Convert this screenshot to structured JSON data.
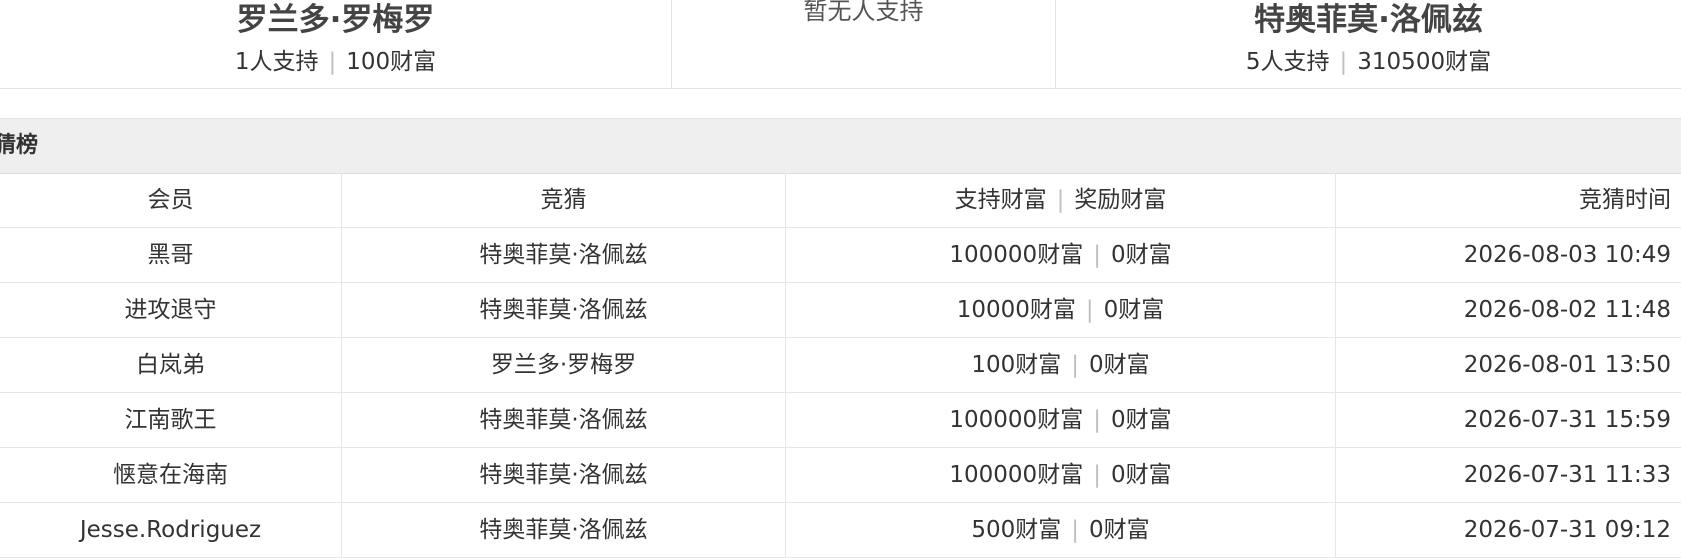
{
  "support_panel": {
    "left": {
      "name": "罗兰多·罗梅罗",
      "supporters": "1人支持",
      "wealth": "100财富"
    },
    "middle": {
      "note": "暂无人支持"
    },
    "right": {
      "name": "特奥菲莫·洛佩兹",
      "supporters": "5人支持",
      "wealth": "310500财富"
    },
    "separator": "|"
  },
  "ranking": {
    "title": "猜榜",
    "headers": {
      "member": "会员",
      "guess": "竞猜",
      "support_wealth": "支持财富",
      "reward_wealth": "奖励财富",
      "time": "竞猜时间"
    },
    "rows": [
      {
        "member": "黑哥",
        "guess": "特奥菲莫·洛佩兹",
        "support": "100000财富",
        "reward": "0财富",
        "time": "2026-08-03 10:49"
      },
      {
        "member": "进攻退守",
        "guess": "特奥菲莫·洛佩兹",
        "support": "10000财富",
        "reward": "0财富",
        "time": "2026-08-02 11:48"
      },
      {
        "member": "白岚弟",
        "guess": "罗兰多·罗梅罗",
        "support": "100财富",
        "reward": "0财富",
        "time": "2026-08-01 13:50"
      },
      {
        "member": "江南歌王",
        "guess": "特奥菲莫·洛佩兹",
        "support": "100000财富",
        "reward": "0财富",
        "time": "2026-07-31 15:59"
      },
      {
        "member": "惬意在海南",
        "guess": "特奥菲莫·洛佩兹",
        "support": "100000财富",
        "reward": "0财富",
        "time": "2026-07-31 11:33"
      },
      {
        "member": "Jesse.Rodriguez",
        "guess": "特奥菲莫·洛佩兹",
        "support": "500财富",
        "reward": "0财富",
        "time": "2026-07-31 09:12"
      }
    ]
  }
}
